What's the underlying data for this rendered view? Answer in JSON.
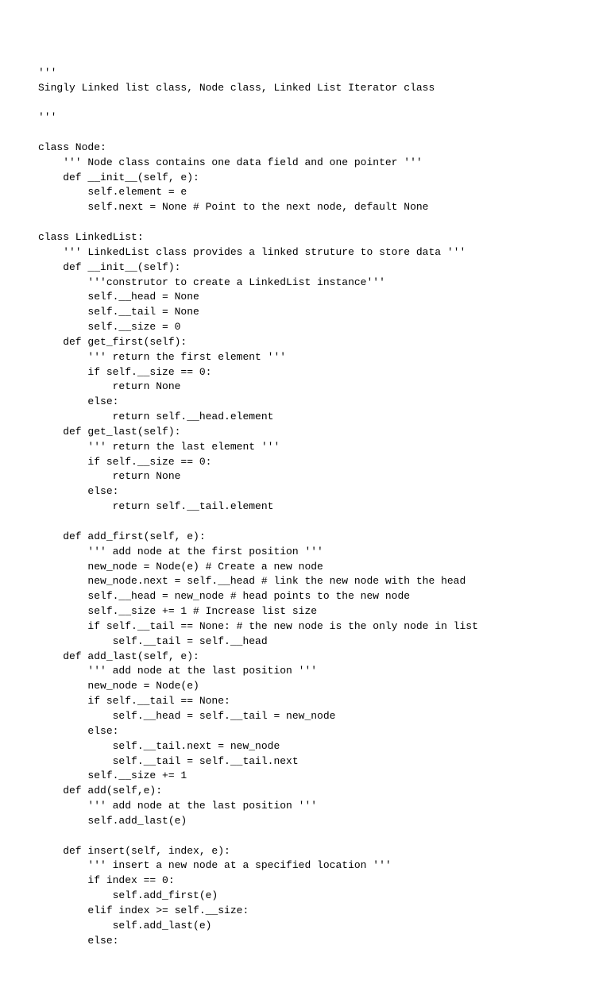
{
  "code_lines": [
    "'''",
    "Singly Linked list class, Node class, Linked List Iterator class",
    "",
    "'''",
    "",
    "class Node:",
    "    ''' Node class contains one data field and one pointer '''",
    "    def __init__(self, e):",
    "        self.element = e",
    "        self.next = None # Point to the next node, default None",
    "",
    "class LinkedList:",
    "    ''' LinkedList class provides a linked struture to store data '''",
    "    def __init__(self):",
    "        '''construtor to create a LinkedList instance'''",
    "        self.__head = None",
    "        self.__tail = None",
    "        self.__size = 0",
    "    def get_first(self):",
    "        ''' return the first element '''",
    "        if self.__size == 0:",
    "            return None",
    "        else:",
    "            return self.__head.element",
    "    def get_last(self):",
    "        ''' return the last element '''",
    "        if self.__size == 0:",
    "            return None",
    "        else:",
    "            return self.__tail.element",
    "",
    "    def add_first(self, e):",
    "        ''' add node at the first position '''",
    "        new_node = Node(e) # Create a new node",
    "        new_node.next = self.__head # link the new node with the head",
    "        self.__head = new_node # head points to the new node",
    "        self.__size += 1 # Increase list size",
    "        if self.__tail == None: # the new node is the only node in list",
    "            self.__tail = self.__head",
    "    def add_last(self, e):",
    "        ''' add node at the last position '''",
    "        new_node = Node(e)",
    "        if self.__tail == None:",
    "            self.__head = self.__tail = new_node",
    "        else:",
    "            self.__tail.next = new_node",
    "            self.__tail = self.__tail.next",
    "        self.__size += 1",
    "    def add(self,e):",
    "        ''' add node at the last position '''",
    "        self.add_last(e)",
    "",
    "    def insert(self, index, e):",
    "        ''' insert a new node at a specified location '''",
    "        if index == 0:",
    "            self.add_first(e)",
    "        elif index >= self.__size:",
    "            self.add_last(e)",
    "        else:"
  ]
}
